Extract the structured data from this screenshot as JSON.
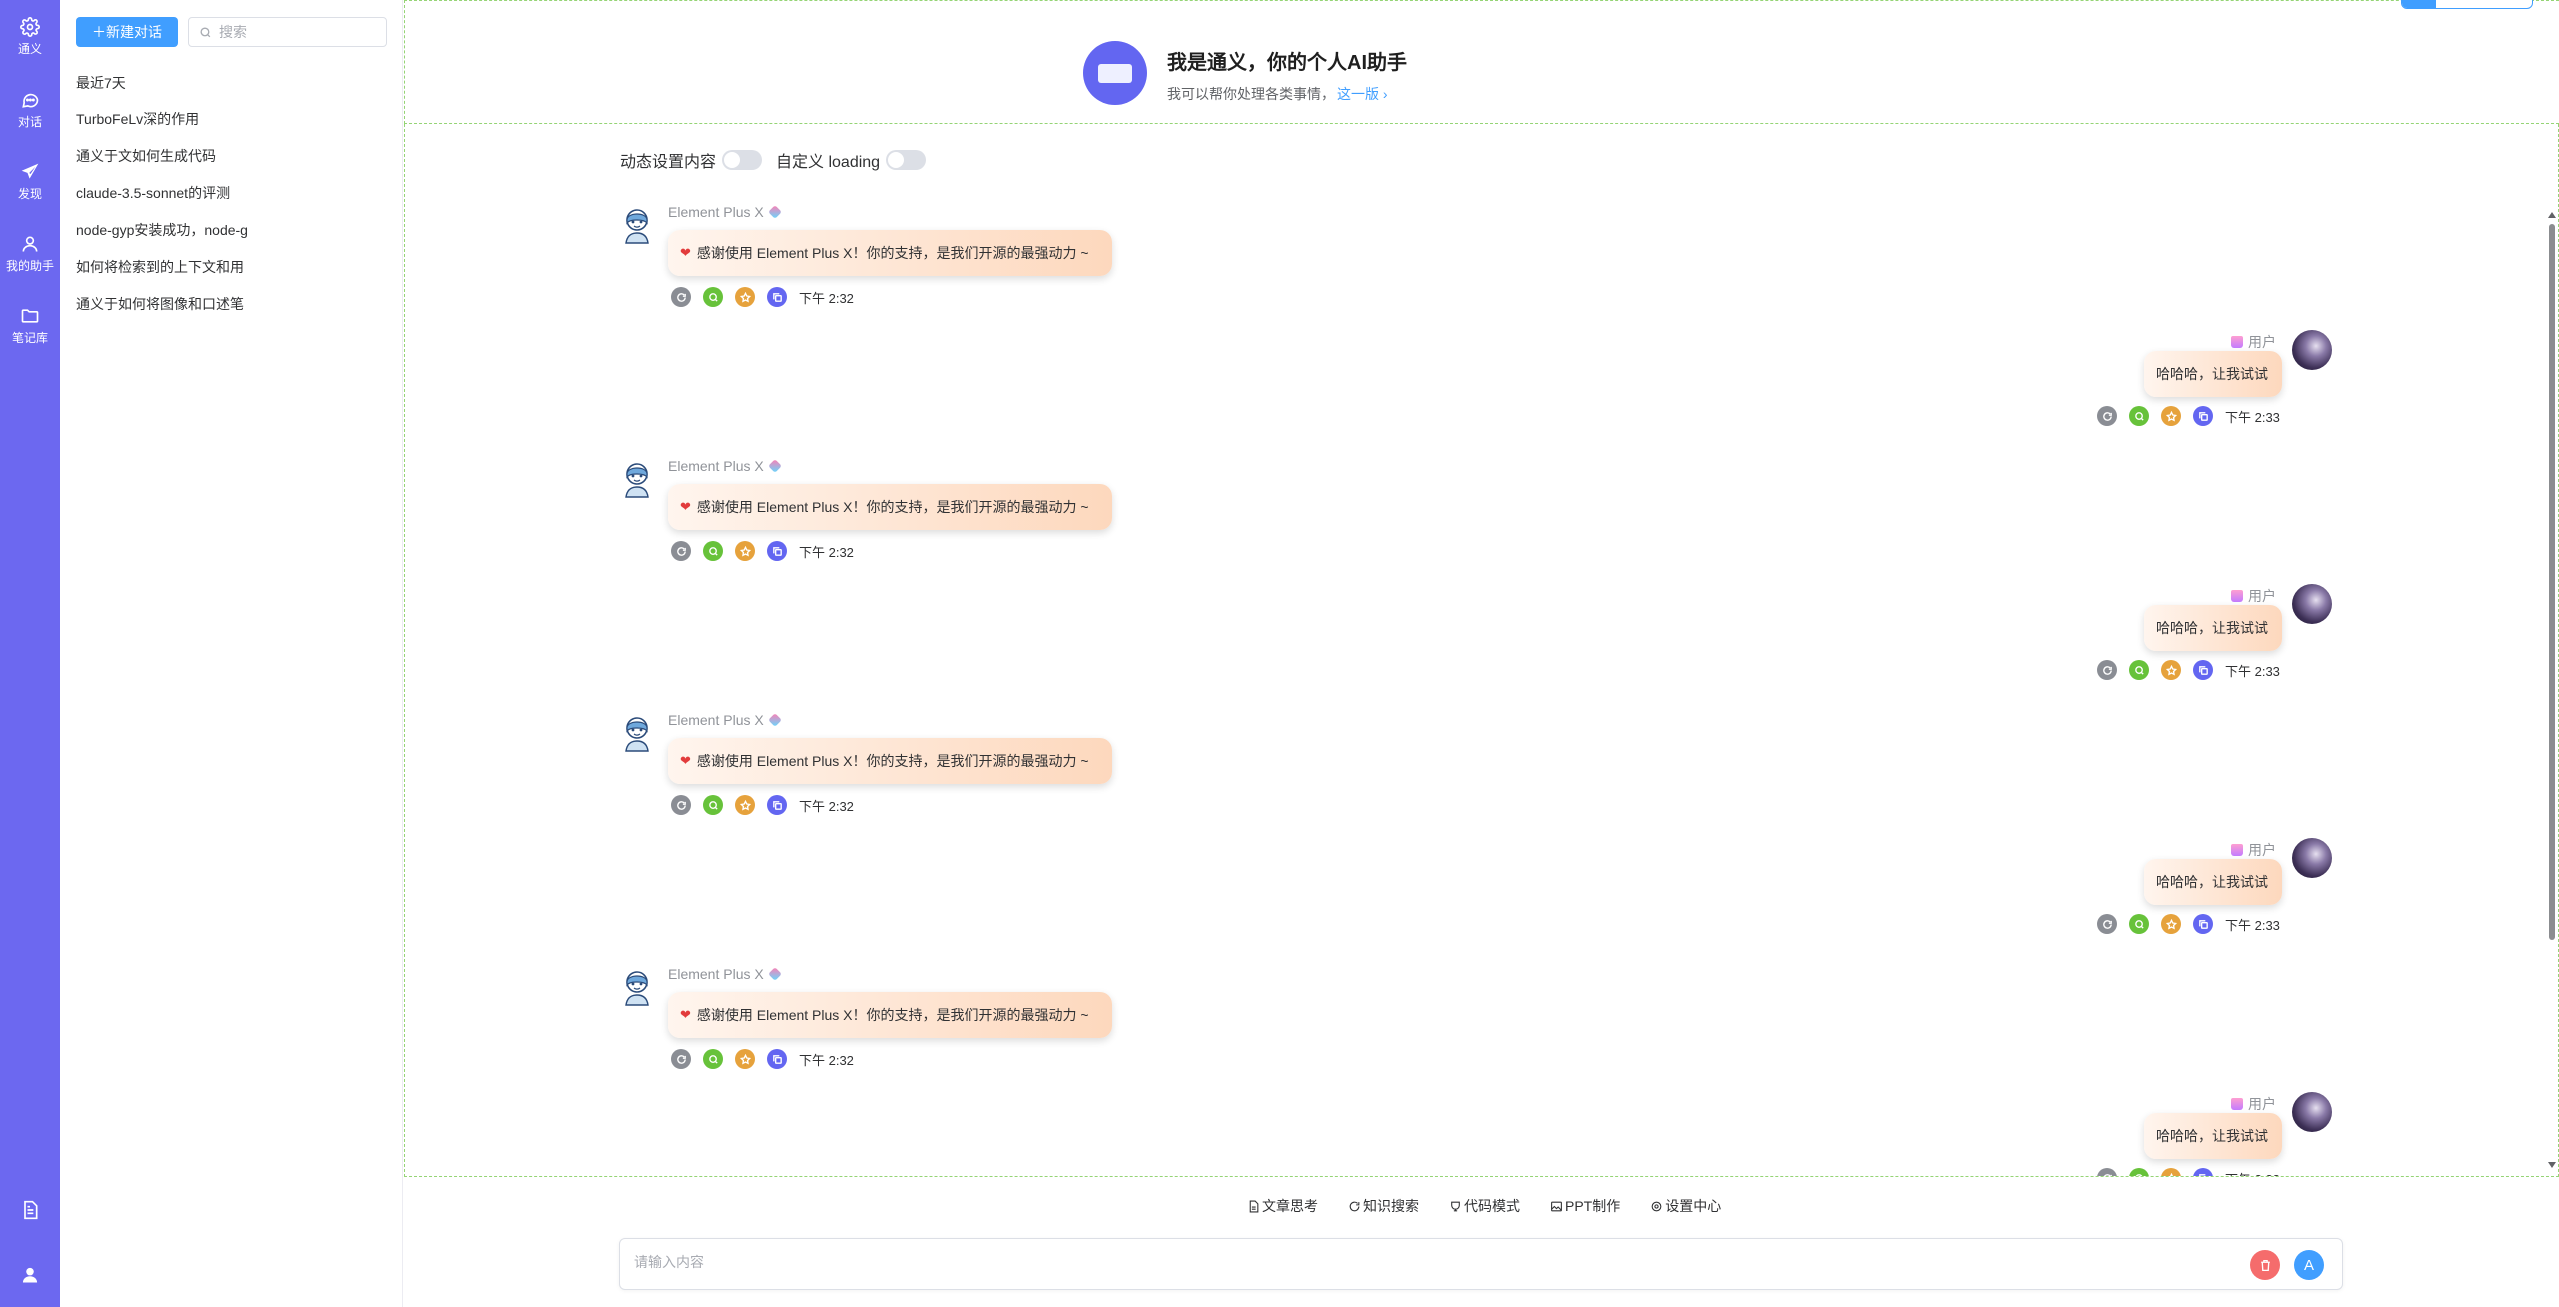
{
  "rail": {
    "items": [
      {
        "label": "通义",
        "icon": "gear-icon"
      },
      {
        "label": "对话",
        "icon": "chat-bubble-icon"
      },
      {
        "label": "发现",
        "icon": "paper-plane-icon"
      },
      {
        "label": "我的助手",
        "icon": "user-icon"
      },
      {
        "label": "笔记库",
        "icon": "folder-icon"
      }
    ],
    "bottom": [
      {
        "icon": "document-icon"
      },
      {
        "icon": "user-profile-icon"
      }
    ],
    "color": "#6c68f0"
  },
  "sidebar": {
    "new_button": "＋新建对话",
    "search_placeholder": "搜索",
    "group_title": "最近7天",
    "conversations": [
      "TurboFeLv深的作用",
      "通义于文如何生成代码",
      "claude-3.5-sonnet的评测",
      "node-gyp安装成功，node-g",
      "如何将检索到的上下文和用",
      "通义于如何将图像和口述笔"
    ]
  },
  "welcome": {
    "title": "我是通义，你的个人AI助手",
    "subtitle": "我可以帮你处理各类事情，",
    "link": "这一版 ›"
  },
  "controls": {
    "toggle1": "动态设置内容",
    "toggle2": "自定义 loading"
  },
  "messages": {
    "ai_name": "Element Plus X",
    "ai_text": "感谢使用 Element Plus X！你的支持，是我们开源的最强动力 ~",
    "ai_time": "下午 2:32",
    "user_name": "用户",
    "user_text": "哈哈哈，让我试试",
    "user_time": "下午 2:33"
  },
  "quick_actions": [
    "文章思考",
    "知识搜索",
    "代码模式",
    "PPT制作",
    "设置中心"
  ],
  "input": {
    "placeholder": "请输入内容",
    "send_label": "A"
  },
  "colors": {
    "primary": "#409eff",
    "accent": "#6366f1",
    "green": "#67c23a",
    "orange": "#e6a23c",
    "danger": "#f56c6c"
  }
}
